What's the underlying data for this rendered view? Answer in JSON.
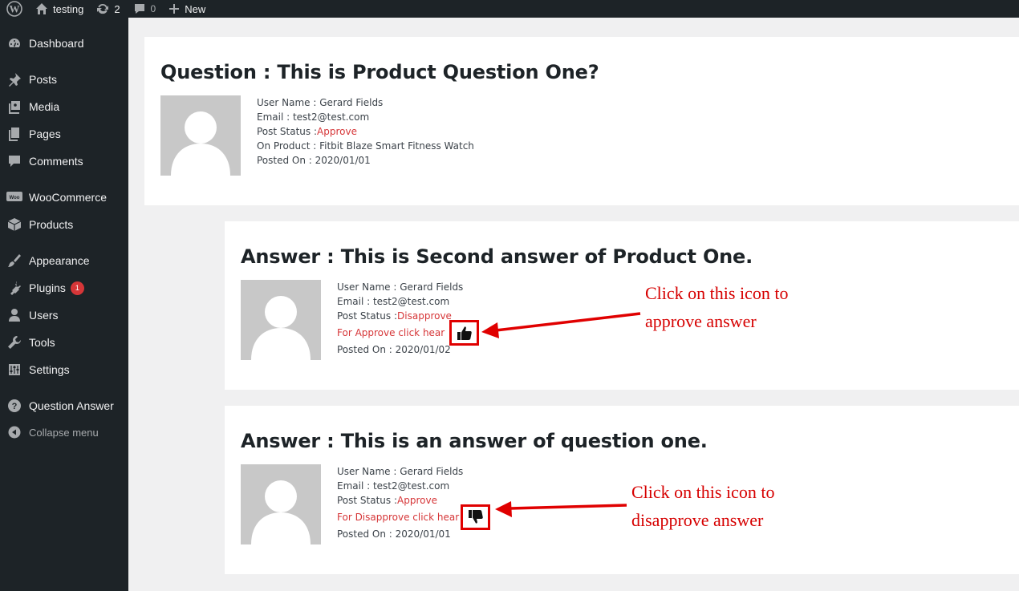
{
  "adminbar": {
    "site_name": "testing",
    "updates_count": "2",
    "comments_count": "0",
    "new_label": "New"
  },
  "sidebar": {
    "items": [
      {
        "label": "Dashboard",
        "icon": "dashboard-icon"
      },
      {
        "label": "Posts",
        "icon": "pin-icon"
      },
      {
        "label": "Media",
        "icon": "media-icon"
      },
      {
        "label": "Pages",
        "icon": "pages-icon"
      },
      {
        "label": "Comments",
        "icon": "comment-icon"
      },
      {
        "label": "WooCommerce",
        "icon": "woo-icon"
      },
      {
        "label": "Products",
        "icon": "box-icon"
      },
      {
        "label": "Appearance",
        "icon": "brush-icon"
      },
      {
        "label": "Plugins",
        "icon": "plug-icon",
        "badge": "1"
      },
      {
        "label": "Users",
        "icon": "user-icon"
      },
      {
        "label": "Tools",
        "icon": "wrench-icon"
      },
      {
        "label": "Settings",
        "icon": "sliders-icon"
      },
      {
        "label": "Question Answer",
        "icon": "help-icon"
      }
    ],
    "collapse_label": "Collapse menu"
  },
  "question": {
    "title": "Question : This is Product Question One?",
    "user_name": "User Name : Gerard Fields",
    "email": "Email : test2@test.com",
    "status_label": "Post Status :",
    "status_value": "Approve",
    "product": "On Product : Fitbit Blaze Smart Fitness Watch",
    "posted_on": "Posted On : 2020/01/01"
  },
  "answers": [
    {
      "title": "Answer : This is Second answer of Product One.",
      "user_name": "User Name : Gerard Fields",
      "email": "Email : test2@test.com",
      "status_label": "Post Status :",
      "status_value": "Disapprove",
      "action_label": "For Approve click hear",
      "action_icon": "thumbs-up-icon",
      "posted_on": "Posted On : 2020/01/02"
    },
    {
      "title": "Answer : This is an answer of question one.",
      "user_name": "User Name : Gerard Fields",
      "email": "Email : test2@test.com",
      "status_label": "Post Status :",
      "status_value": "Approve",
      "action_label": "For Disapprove click hear",
      "action_icon": "thumbs-down-icon",
      "posted_on": "Posted On : 2020/01/01"
    }
  ],
  "annotations": {
    "approve_line1": "Click on this icon to",
    "approve_line2": "approve answer",
    "disapprove_line1": "Click on this icon to",
    "disapprove_line2": "disapprove answer"
  },
  "colors": {
    "accent_red": "#d63638",
    "annotation_red": "#e00000",
    "admin_dark": "#1d2327"
  }
}
